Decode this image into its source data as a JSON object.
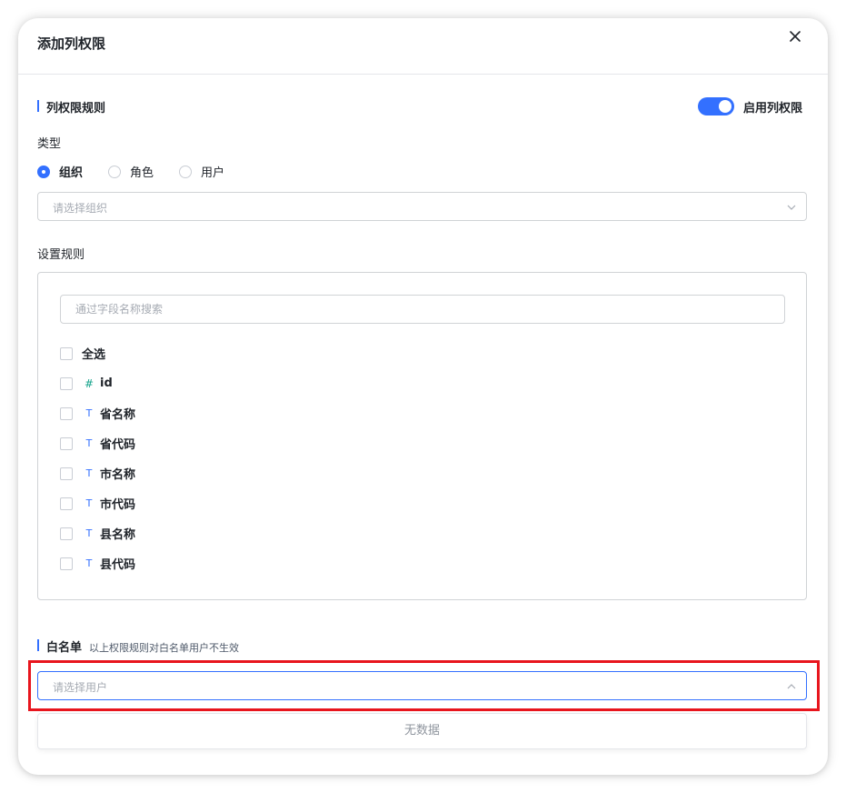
{
  "dialog": {
    "title": "添加列权限"
  },
  "rules_section": {
    "title": "列权限规则",
    "toggle_label": "启用列权限",
    "toggle_on": true
  },
  "type_field": {
    "label": "类型",
    "options": [
      {
        "label": "组织",
        "checked": true
      },
      {
        "label": "角色",
        "checked": false
      },
      {
        "label": "用户",
        "checked": false
      }
    ],
    "select_placeholder": "请选择组织"
  },
  "set_rules": {
    "label": "设置规则",
    "search_placeholder": "通过字段名称搜索",
    "select_all_label": "全选",
    "fields": [
      {
        "type_icon": "#",
        "type": "number",
        "name": "id"
      },
      {
        "type_icon": "T",
        "type": "text",
        "name": "省名称"
      },
      {
        "type_icon": "T",
        "type": "text",
        "name": "省代码"
      },
      {
        "type_icon": "T",
        "type": "text",
        "name": "市名称"
      },
      {
        "type_icon": "T",
        "type": "text",
        "name": "市代码"
      },
      {
        "type_icon": "T",
        "type": "text",
        "name": "县名称"
      },
      {
        "type_icon": "T",
        "type": "text",
        "name": "县代码"
      }
    ]
  },
  "whitelist": {
    "title": "白名单",
    "hint": "以上权限规则对白名单用户不生效",
    "select_placeholder": "请选择用户",
    "empty_text": "无数据"
  },
  "colors": {
    "accent": "#3370ff",
    "highlight": "#e8151d",
    "number_icon": "#14a38b"
  }
}
